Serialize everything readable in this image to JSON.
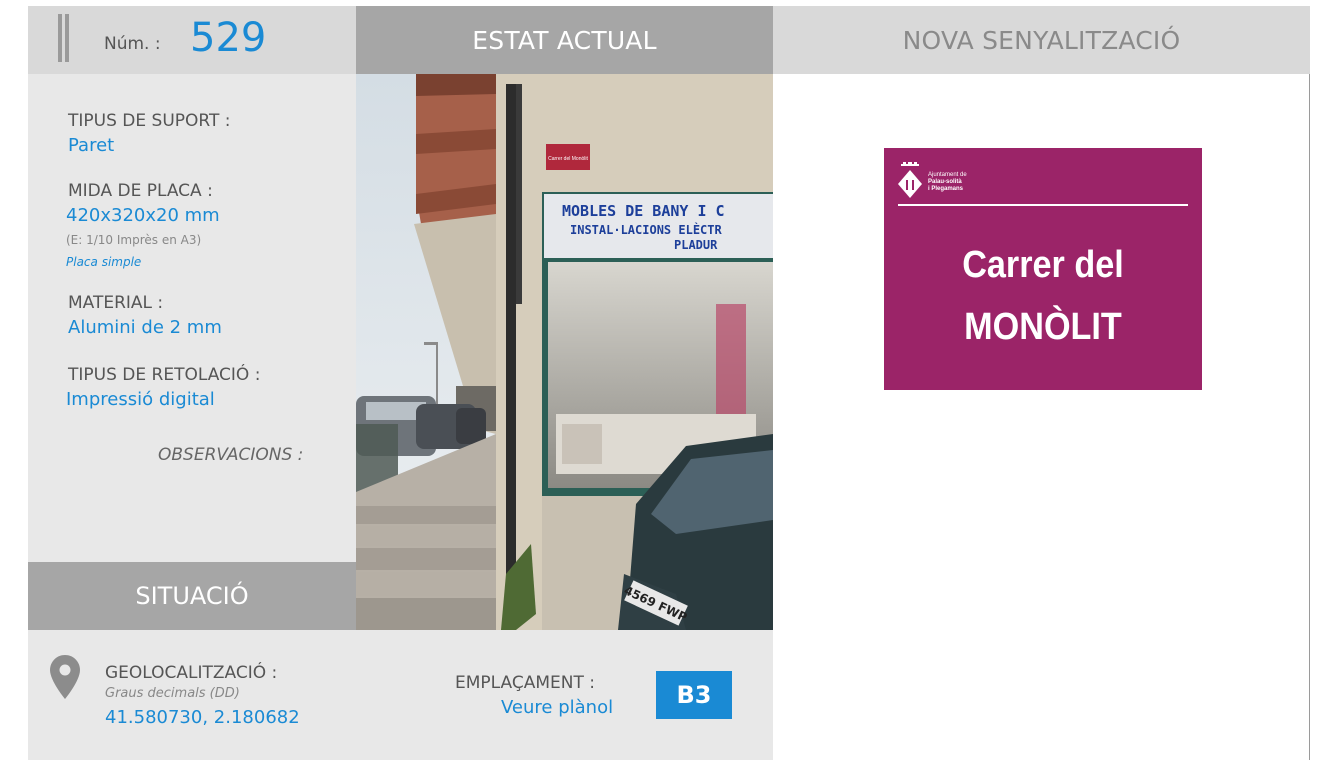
{
  "header": {
    "num_label": "Núm. :",
    "num_value": "529",
    "estat_actual": "ESTAT ACTUAL",
    "nova_senyalitzacio": "NOVA SENYALITZACIÓ"
  },
  "fields": {
    "tipus_suport_label": "TIPUS DE SUPORT :",
    "tipus_suport_value": "Paret",
    "mida_placa_label": "MIDA DE PLACA :",
    "mida_placa_value": "420x320x20 mm",
    "mida_placa_scale": "(E: 1/10 Imprès en A3)",
    "mida_placa_type": "Placa simple",
    "material_label": "MATERIAL :",
    "material_value": "Alumini de 2 mm",
    "retolacio_label": "TIPUS DE RETOLACIÓ :",
    "retolacio_value": "Impressió digital",
    "observacions_label": "OBSERVACIONS :"
  },
  "situacio": {
    "title": "SITUACIÓ",
    "geo_label": "GEOLOCALITZACIÓ :",
    "geo_format": "Graus decimals (DD)",
    "geo_value": "41.580730, 2.180682",
    "emplacament_label": "EMPLAÇAMENT :",
    "emplacament_link": "Veure plànol",
    "emplacament_code": "B3"
  },
  "photo": {
    "shop_sign_line1": "MOBLES DE BANY I C",
    "shop_sign_line2": "INSTAL·LACIONS ELÈCTR",
    "shop_sign_line3": "PLADUR",
    "plate_text": "Carrer del Monòlit",
    "car_plate": "4569 FWP"
  },
  "sign": {
    "logo_line1": "Ajuntament de",
    "logo_line2": "Palau-solità",
    "logo_line3": "i Plegamans",
    "line1": "Carrer del",
    "line2": "MONÒLIT",
    "color": "#9b2468"
  },
  "colors": {
    "accent": "#1a8ad4",
    "header_gray": "#a6a6a6",
    "panel_gray": "#e8e8e8"
  }
}
